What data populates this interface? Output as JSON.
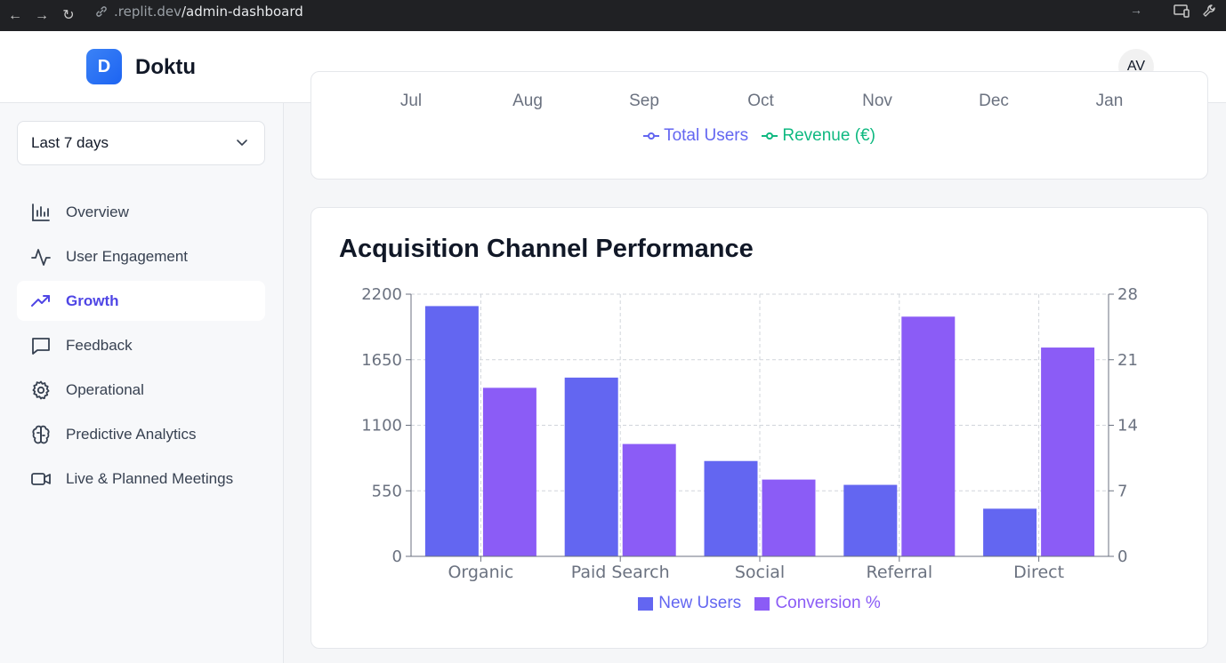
{
  "browser": {
    "url_host": ".replit.dev",
    "url_path": "/admin-dashboard"
  },
  "header": {
    "logo_letter": "D",
    "brand": "Doktu",
    "avatar_initials": "AV"
  },
  "sidebar": {
    "range": "Last 7 days",
    "items": [
      {
        "label": "Overview",
        "icon": "bar-chart-icon",
        "active": false
      },
      {
        "label": "User Engagement",
        "icon": "activity-icon",
        "active": false
      },
      {
        "label": "Growth",
        "icon": "trending-up-icon",
        "active": true
      },
      {
        "label": "Feedback",
        "icon": "message-square-icon",
        "active": false
      },
      {
        "label": "Operational",
        "icon": "gear-icon",
        "active": false
      },
      {
        "label": "Predictive Analytics",
        "icon": "brain-icon",
        "active": false
      },
      {
        "label": "Live & Planned Meetings",
        "icon": "video-icon",
        "active": false
      }
    ]
  },
  "top_chart": {
    "months": [
      "Jul",
      "Aug",
      "Sep",
      "Oct",
      "Nov",
      "Dec",
      "Jan"
    ],
    "legend": [
      {
        "label": "Total Users",
        "color": "#6366f1"
      },
      {
        "label": "Revenue (€)",
        "color": "#10b981"
      }
    ]
  },
  "acquisition": {
    "title": "Acquisition Channel Performance"
  },
  "chart_data": {
    "type": "bar",
    "title": "Acquisition Channel Performance",
    "categories": [
      "Organic",
      "Paid Search",
      "Social",
      "Referral",
      "Direct"
    ],
    "series": [
      {
        "name": "New Users",
        "axis": "left",
        "color": "#6366f1",
        "values": [
          2100,
          1500,
          800,
          600,
          400
        ]
      },
      {
        "name": "Conversion %",
        "axis": "right",
        "color": "#8b5cf6",
        "values": [
          18,
          12,
          8.2,
          25.6,
          22.3
        ]
      }
    ],
    "y_left": {
      "ticks": [
        0,
        550,
        1100,
        1650,
        2200
      ],
      "lim": [
        0,
        2200
      ]
    },
    "y_right": {
      "ticks": [
        0,
        7,
        14,
        21,
        28
      ],
      "lim": [
        0,
        28
      ]
    },
    "grid": true,
    "legend_position": "bottom"
  }
}
